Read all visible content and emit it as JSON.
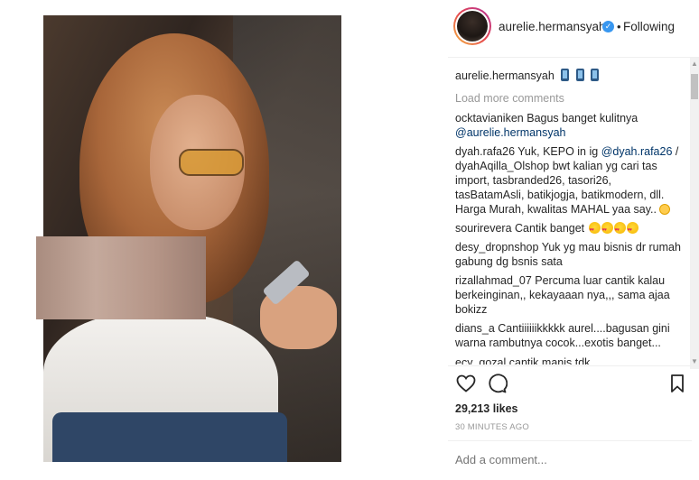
{
  "post": {
    "username": "aurelie.hermansyah",
    "follow_status": "Following",
    "separator": "•",
    "caption_username": "aurelie.hermansyah",
    "load_more": "Load more comments",
    "likes": "29,213 likes",
    "timestamp": "30 MINUTES AGO",
    "add_comment_placeholder": "Add a comment..."
  },
  "comments": [
    {
      "user": "ocktavianiken",
      "text": "Bagus banget kulitnya",
      "line2_mention": "@aurelie.hermansyah"
    },
    {
      "user": "dyah.rafa26",
      "text": "Yuk, KEPO in ig",
      "mention": "@dyah.rafa26",
      "rest": "/ dyahAqilla_Olshop bwt kalian yg cari tas import, tasbranded26, tasori26, tasBatamAsli, batikjogja, batikmodern, dll. Harga Murah, kwalitas MAHAL yaa say.."
    },
    {
      "user": "sourirevera",
      "text": "Cantik banget"
    },
    {
      "user": "desy_dropnshop",
      "text": "Yuk yg mau bisnis dr rumah gabung dg bsnis sata"
    },
    {
      "user": "rizallahmad_07",
      "text": "Percuma luar cantik kalau berkeinginan,, kekayaaan nya,,, sama ajaa bokizz"
    },
    {
      "user": "dians_a",
      "text": "Cantiiiiiikkkkk aurel....bagusan gini warna rambutnya cocok...exotis banget..."
    },
    {
      "user": "ecy_gozal",
      "text": "cantik manis tdk"
    }
  ],
  "icons": {
    "verified": "verified-badge-icon",
    "like": "heart-outline-icon",
    "comment": "speech-bubble-icon",
    "save": "bookmark-icon",
    "caption_emoji": "mobile-phone-emoji",
    "heart_eyes": "heart-eyes-emoji",
    "smile": "smile-emoji"
  },
  "colors": {
    "verified": "#3897f0",
    "muted_text": "#999999",
    "mention": "#003569",
    "border": "#efefef"
  }
}
